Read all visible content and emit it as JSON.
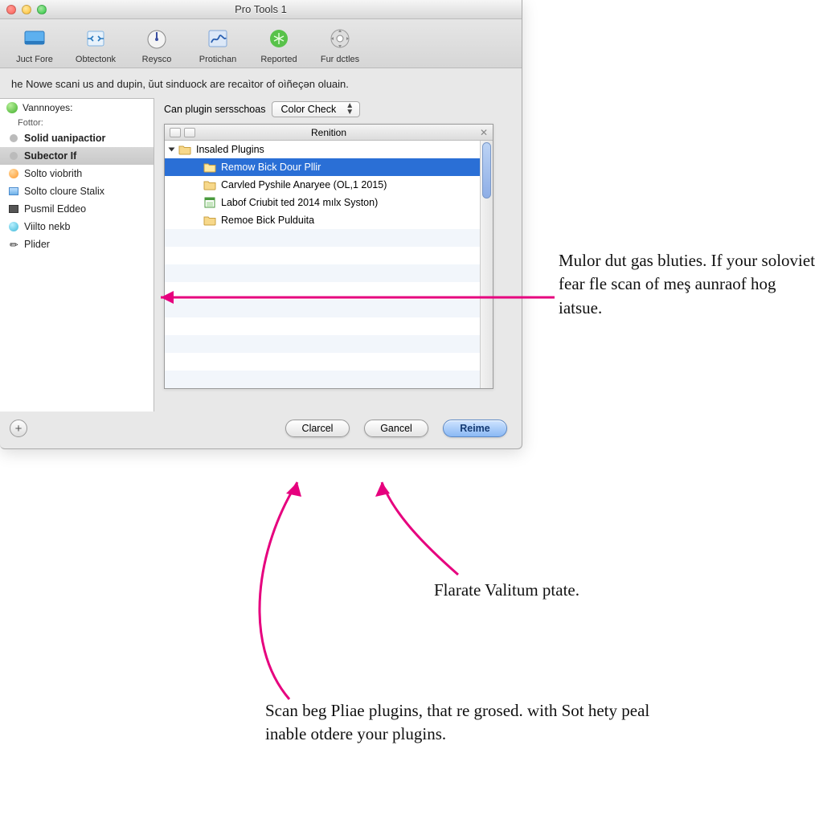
{
  "window": {
    "title": "Pro Tools 1",
    "instruction": "he Nowe scani us and dupin, ŭut sinduock are recaìtor of oìñeçən oluain."
  },
  "toolbar": [
    {
      "label": "Juct Fore",
      "color": "#4fa7e6"
    },
    {
      "label": "Obtectonk",
      "color": "#6fb2e8"
    },
    {
      "label": "Reysco",
      "color": "#4a5fa0"
    },
    {
      "label": "Protichan",
      "color": "#3d78c8"
    },
    {
      "label": "Reported",
      "color": "#4aad3e"
    },
    {
      "label": "Fur dctles",
      "color": "#9a9a9a"
    }
  ],
  "sidebar": {
    "heading": "Vannnoyes:",
    "subheading": "Fottor:",
    "items": [
      {
        "label": "Solid uanipactior",
        "icon": "dot-gray",
        "bold": true
      },
      {
        "label": "Subector If",
        "icon": "dot-gray",
        "bold": true,
        "selected": true
      },
      {
        "label": "Solto viobrith",
        "icon": "circle-orange"
      },
      {
        "label": "Solto cloure Stalix",
        "icon": "square-blue"
      },
      {
        "label": "Pusmil Eddeo",
        "icon": "square-dark"
      },
      {
        "label": "Viilto nekb",
        "icon": "circle-teal"
      },
      {
        "label": "Plider",
        "icon": "pencil"
      }
    ]
  },
  "settings": {
    "label": "Can plugin sersschoas",
    "select_value": "Color Check"
  },
  "tree": {
    "title": "Renition",
    "root": "Insaled Plugins",
    "items": [
      {
        "label": "Remow Bick Dour Pllir",
        "icon": "folder",
        "selected": true
      },
      {
        "label": "Carvled Pyshile Anaryee (OL,1 2015)",
        "icon": "folder"
      },
      {
        "label": "Labof Criubit ted 2014 mılx Syston)",
        "icon": "sheet"
      },
      {
        "label": "Remoe Bick Pulduita",
        "icon": "folder"
      }
    ]
  },
  "buttons": {
    "clarcel": "Clarcel",
    "gancel": "Gancel",
    "reime": "Reime"
  },
  "annotations": {
    "a1": "Mulor dut gas bluties. If your soloviet fear fle scan of meş aunraof hog iatsue.",
    "a2": "Flarate Valitum ptate.",
    "a3": "Scan beg Pliae plugins, that re grosed. with Sot hety peal inable otdere your plugins."
  }
}
